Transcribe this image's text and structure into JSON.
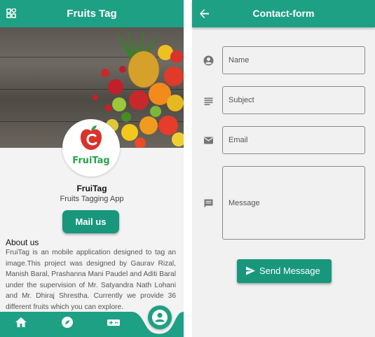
{
  "left_screen": {
    "appbar": {
      "title": "Fruits Tag",
      "menu_icon": "dashboard-grid-icon"
    },
    "logo": {
      "word": "FruiTag",
      "accent": "#2aa34a",
      "apple_color": "#d9332b"
    },
    "app_name": "FruiTag",
    "app_subtitle": "Fruits Tagging App",
    "mail_button": "Mail us",
    "about": {
      "title": "About us",
      "body": "FruiTag is an mobile application designed to tag an image.This project was designed by Gaurav Rizal, Manish Baral, Prashanna Mani Paudel and Aditi Baral under the supervision of Mr. Satyandra Nath Lohani and Mr. Dhiraj Shrestha. Currently we provide 36 different fruits which you can explore."
    },
    "bottom_nav": {
      "items": [
        "home-icon",
        "explore-compass-icon",
        "gamepad-icon",
        "person-icon"
      ],
      "active_index": 3
    }
  },
  "right_screen": {
    "appbar": {
      "title": "Contact-form",
      "back_icon": "arrow-back-icon"
    },
    "fields": [
      {
        "icon": "account-circle-icon",
        "placeholder": "Name"
      },
      {
        "icon": "subject-lines-icon",
        "placeholder": "Subject"
      },
      {
        "icon": "email-envelope-icon",
        "placeholder": "Email"
      },
      {
        "icon": "message-bubble-icon",
        "placeholder": "Message"
      }
    ],
    "send_button": {
      "label": "Send Message",
      "icon": "send-icon"
    }
  },
  "colors": {
    "primary": "#1ea085",
    "button": "#18977c",
    "accent_pink": "#e05a88"
  }
}
